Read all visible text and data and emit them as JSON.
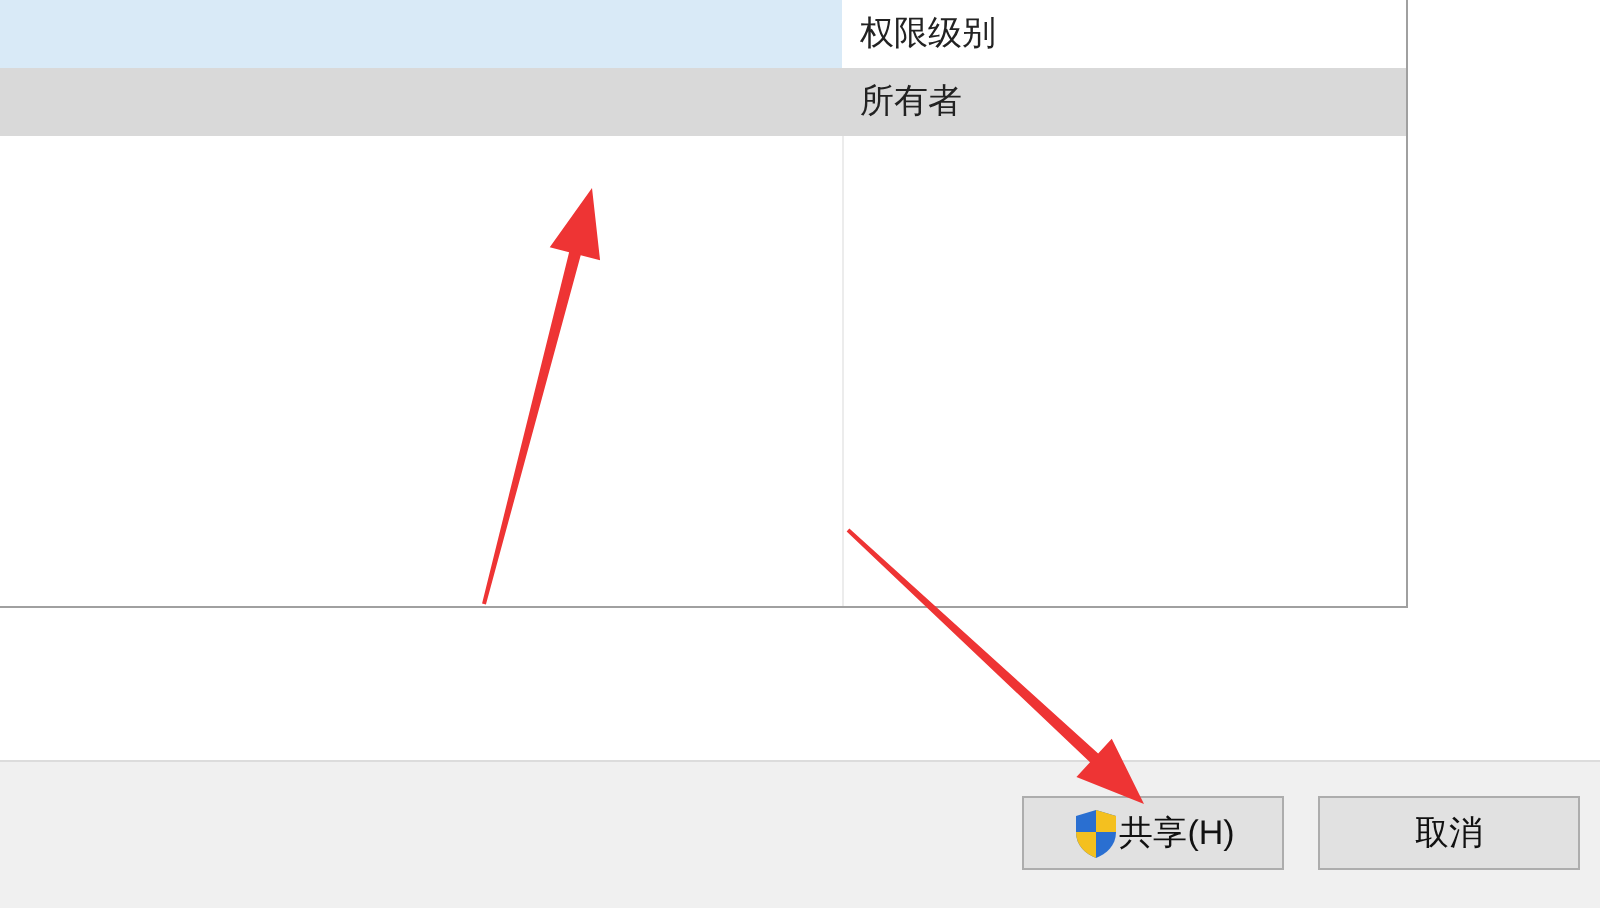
{
  "list": {
    "rows": [
      {
        "permission": "权限级别",
        "highlighted": true,
        "selected": false
      },
      {
        "permission": "所有者",
        "highlighted": false,
        "selected": true
      }
    ]
  },
  "buttons": [
    {
      "label": "共享(H)",
      "kind": "shield"
    },
    {
      "label": "取消",
      "kind": "plain"
    }
  ]
}
